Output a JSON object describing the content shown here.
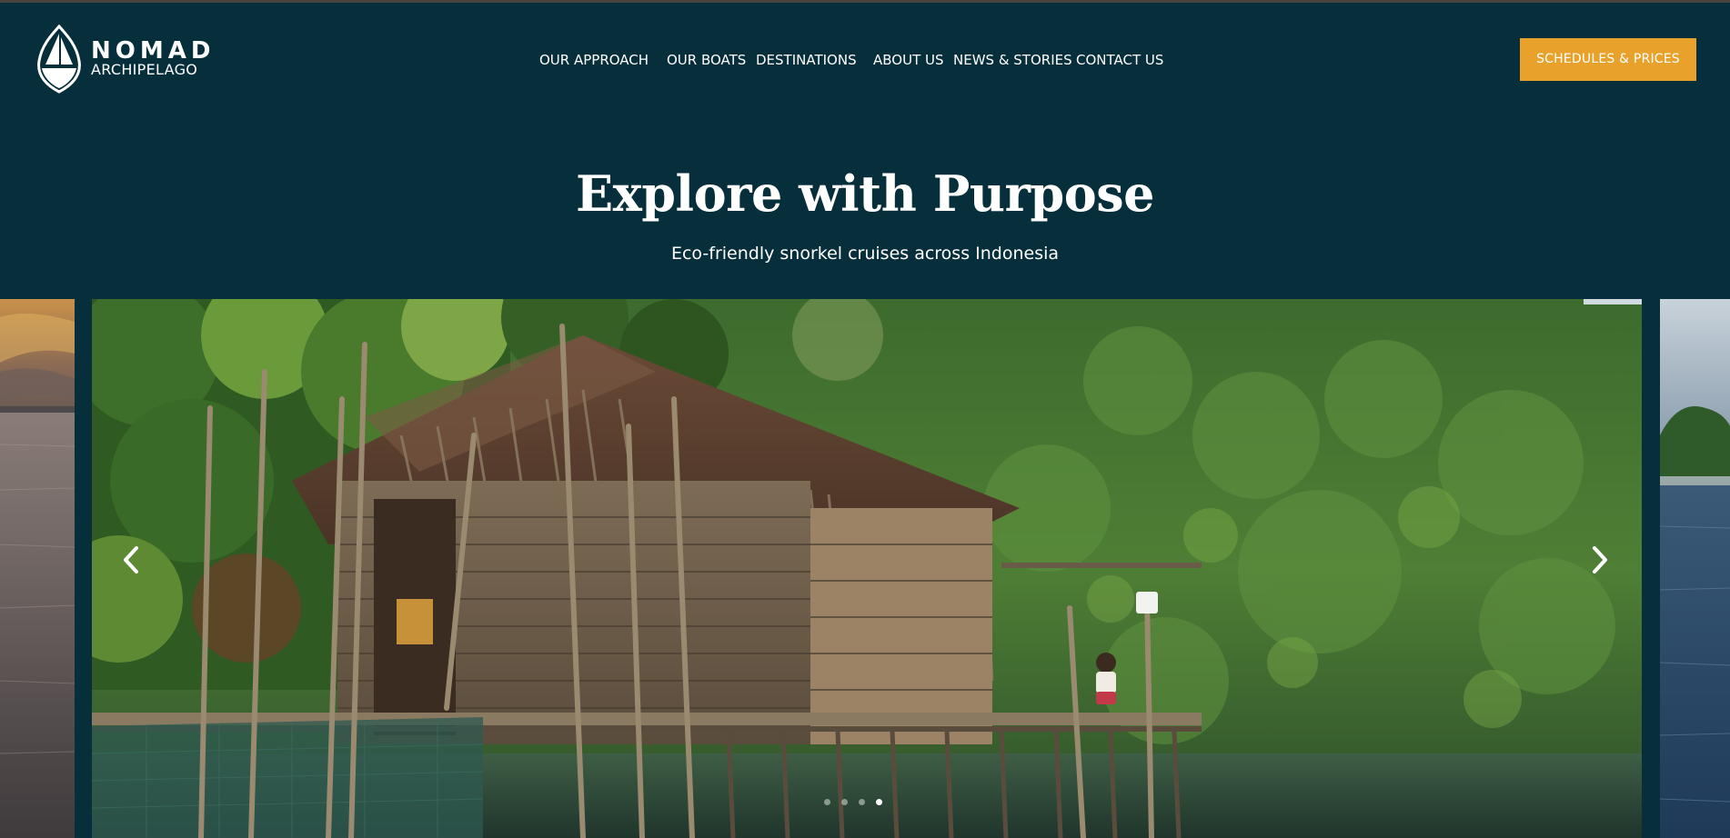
{
  "brand": {
    "name": "NOMAD",
    "subtitle": "ARCHIPELAGO",
    "logo_icon": "sailboat-shield-icon"
  },
  "nav": {
    "items": [
      {
        "label": "OUR APPROACH"
      },
      {
        "label": "OUR BOATS"
      },
      {
        "label": "DESTINATIONS"
      },
      {
        "label": "ABOUT US"
      },
      {
        "label": "NEWS & STORIES"
      },
      {
        "label": "CONTACT US"
      }
    ]
  },
  "cta": {
    "label": "SCHEDULES & PRICES",
    "color": "#e8a22c"
  },
  "hero": {
    "title": "Explore with Purpose",
    "subtitle": "Eco-friendly snorkel cruises across Indonesia"
  },
  "carousel": {
    "prev_icon": "chevron-left-icon",
    "next_icon": "chevron-right-icon",
    "dots_count": 4,
    "active_index": 3
  },
  "colors": {
    "background": "#062e3b",
    "accent": "#e8a22c",
    "text": "#ffffff"
  }
}
